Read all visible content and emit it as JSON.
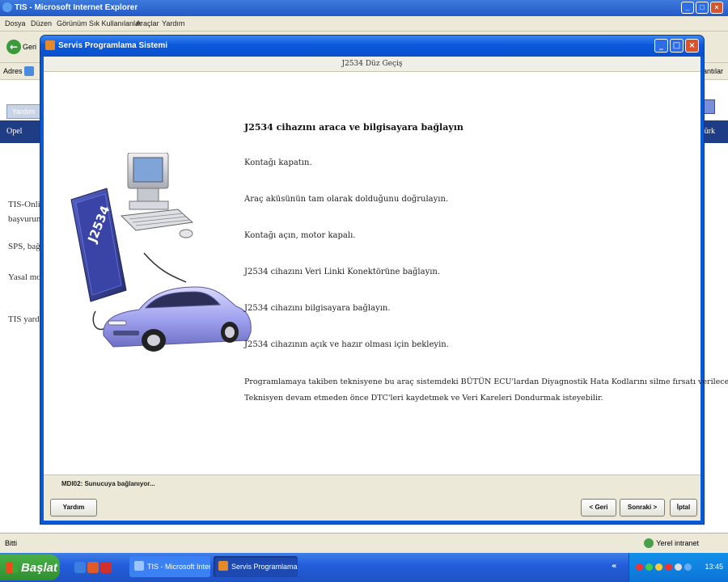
{
  "ie": {
    "title": "TIS - Microsoft Internet Explorer",
    "menu": [
      "Dosya",
      "Düzen",
      "Görünüm",
      "Sık Kullanılanlar",
      "Araçlar",
      "Yardım"
    ],
    "back_label": "Geri",
    "address_label": "Adres",
    "go_label": "Bağlantılar",
    "tab_label": "Yardım",
    "nav_left": "Opel",
    "nav_right": "Türk",
    "page_lines": [
      "TIS-Online",
      "başvurun",
      "SPS, bağla",
      "Yasal mo",
      "TIS yardım"
    ],
    "status_left": "Bitti",
    "status_right": "Yerel intranet"
  },
  "taskbar": {
    "start_label": "Başlat",
    "tasks": [
      "TIS - Microsoft Intern...",
      "Servis Programlama S..."
    ],
    "clock": "13:45"
  },
  "dialog": {
    "title": "Servis Programlama Sistemi",
    "subtitle": "J2534 Düz Geçiş",
    "heading": "J2534 cihazını araca ve bilgisayara bağlayın",
    "steps": [
      "Kontağı kapatın.",
      "Araç aküsünün tam olarak dolduğunu doğrulayın.",
      "Kontağı açın, motor kapalı.",
      "J2534 cihazını Veri Linki Konektörüne bağlayın.",
      "J2534 cihazını bilgisayara bağlayın.",
      "J2534 cihazının açık ve hazır olması için bekleyin."
    ],
    "note_lines": [
      "Programlamaya takiben teknisyene bu araç sistemdeki BÜTÜN ECU'lardan Diyagnostik Hata Kodlarını silme fırsatı verilecektir.",
      "Teknisyen devam etmeden önce DTC'leri kaydetmek ve Veri Kareleri Dondurmak isteyebilir."
    ],
    "device_label": "J2534",
    "status_text": "MDI02: Sunucuya bağlanıyor...",
    "buttons": {
      "help": "Yardım",
      "back": "< Geri",
      "next": "Sonraki >",
      "cancel": "İptal"
    }
  },
  "colors": {
    "titlebar": "#0a4fcc",
    "close": "#d9542c",
    "navbar": "#1f3d85",
    "taskbar": "#245edc",
    "start": "#3a9e3a"
  }
}
